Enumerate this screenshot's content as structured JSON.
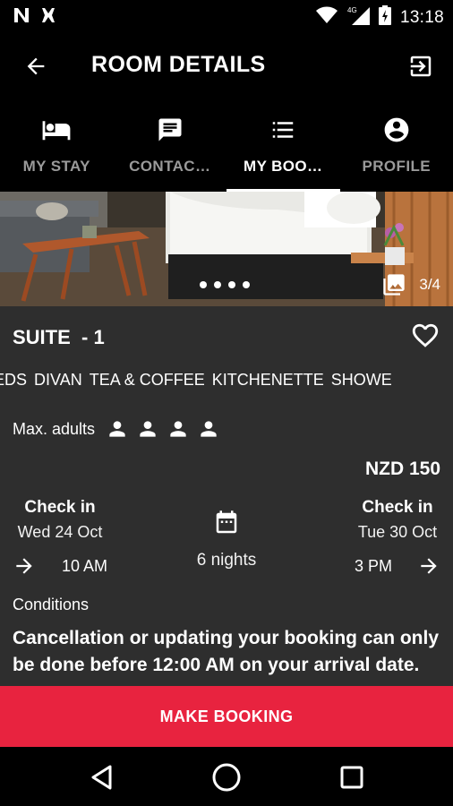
{
  "status_bar": {
    "time": "13:18",
    "network": "4G"
  },
  "header": {
    "title": "ROOM DETAILS"
  },
  "tabs": [
    {
      "label": "MY STAY",
      "icon": "bed-icon",
      "active": false
    },
    {
      "label": "CONTAC…",
      "icon": "chat-icon",
      "active": false
    },
    {
      "label": "MY BOO…",
      "icon": "list-icon",
      "active": true
    },
    {
      "label": "PROFILE",
      "icon": "account-icon",
      "active": false
    }
  ],
  "gallery": {
    "counter": "3/4"
  },
  "room": {
    "name": "SUITE  - 1",
    "amenities": [
      "E BEDS",
      "DIVAN",
      "TEA & COFFEE",
      "KITCHENETTE",
      "SHOWE"
    ],
    "max_adults_label": "Max. adults",
    "price": "NZD 150"
  },
  "stay": {
    "checkin_title": "Check in",
    "checkin_date": "Wed 24 Oct",
    "checkin_time": "10 AM",
    "nights": "6 nights",
    "checkout_title": "Check in",
    "checkout_date": "Tue 30 Oct",
    "checkout_time": "3 PM"
  },
  "conditions": {
    "label": "Conditions",
    "text": "Cancellation or updating your booking can only be done before 12:00 AM on your arrival date."
  },
  "actions": {
    "make_booking": "MAKE BOOKING"
  },
  "colors": {
    "accent": "#e8233f",
    "panel": "#2e2e2e",
    "background": "#000000"
  }
}
